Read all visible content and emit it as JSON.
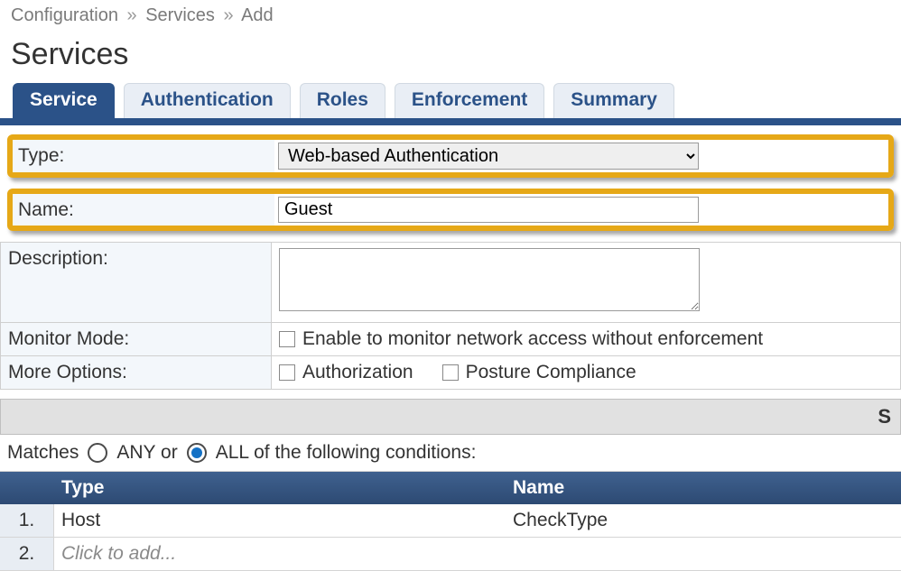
{
  "breadcrumb": {
    "items": [
      "Configuration",
      "Services",
      "Add"
    ],
    "separator": "»"
  },
  "page_title": "Services",
  "tabs": [
    {
      "label": "Service",
      "active": true
    },
    {
      "label": "Authentication",
      "active": false
    },
    {
      "label": "Roles",
      "active": false
    },
    {
      "label": "Enforcement",
      "active": false
    },
    {
      "label": "Summary",
      "active": false
    }
  ],
  "form": {
    "type": {
      "label": "Type:",
      "value": "Web-based Authentication"
    },
    "name": {
      "label": "Name:",
      "value": "Guest"
    },
    "description": {
      "label": "Description:",
      "value": ""
    },
    "monitor_mode": {
      "label": "Monitor Mode:",
      "checkbox_label": "Enable to monitor network access without enforcement",
      "checked": false
    },
    "more_options": {
      "label": "More Options:",
      "options": [
        {
          "label": "Authorization",
          "checked": false
        },
        {
          "label": "Posture Compliance",
          "checked": false
        }
      ]
    }
  },
  "section_bar_partial": "S",
  "matches": {
    "prefix": "Matches",
    "any_label": "ANY or",
    "all_label": "ALL of the following conditions:",
    "selected": "all"
  },
  "conditions": {
    "headers": {
      "type": "Type",
      "name": "Name"
    },
    "rows": [
      {
        "num": "1.",
        "type": "Host",
        "name": "CheckType"
      },
      {
        "num": "2.",
        "type_placeholder": "Click to add...",
        "name": ""
      }
    ]
  }
}
